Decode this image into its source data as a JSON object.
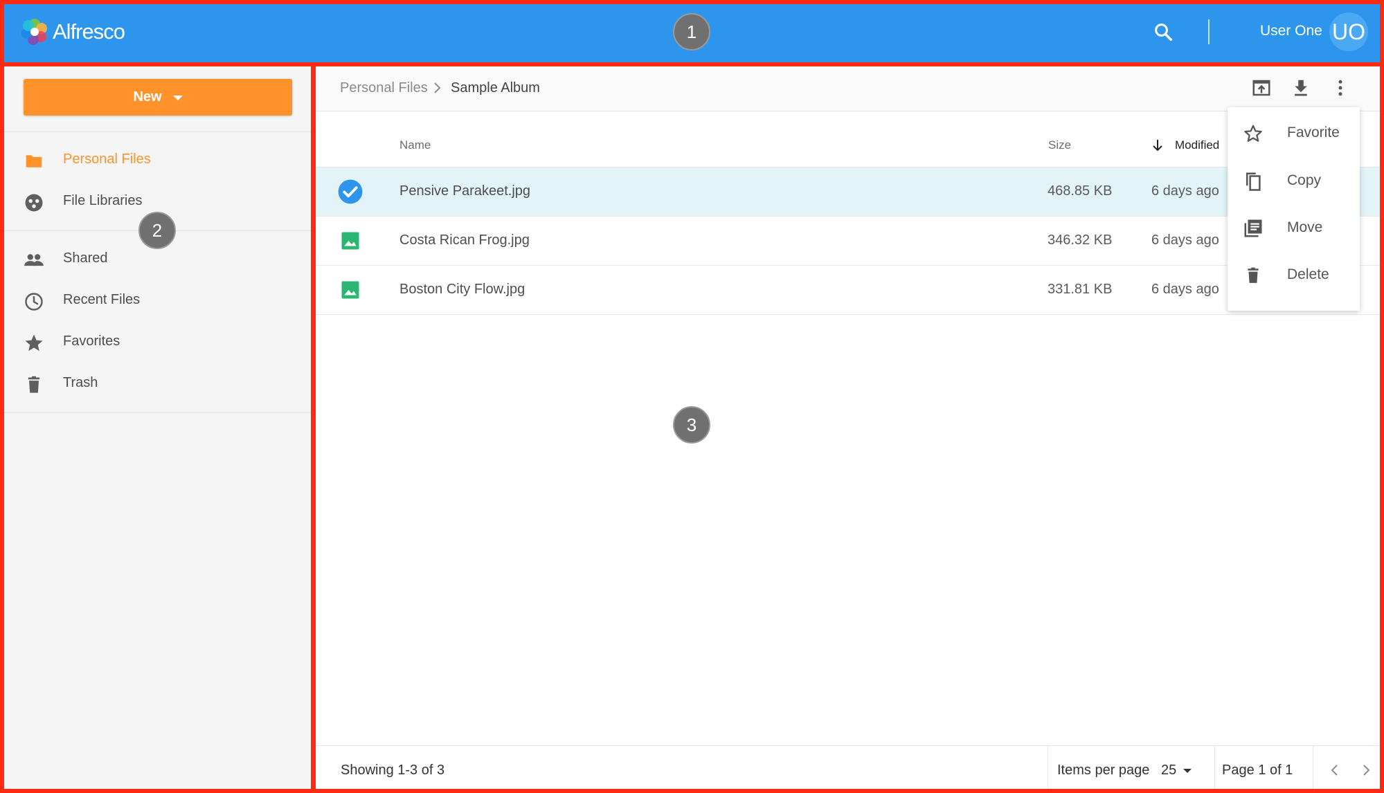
{
  "header": {
    "logo_text": "Alfresco",
    "user_name": "User One",
    "avatar_initials": "UO",
    "brand_color": "#2D96EC"
  },
  "sidebar": {
    "new_button": "New",
    "accent_color": "#FF922B",
    "items": [
      {
        "label": "Personal Files",
        "icon": "folder-icon",
        "active": true
      },
      {
        "label": "File Libraries",
        "icon": "libraries-icon",
        "active": false
      },
      {
        "label": "Shared",
        "icon": "people-icon",
        "active": false
      },
      {
        "label": "Recent Files",
        "icon": "clock-icon",
        "active": false
      },
      {
        "label": "Favorites",
        "icon": "star-icon",
        "active": false
      },
      {
        "label": "Trash",
        "icon": "trash-icon",
        "active": false
      }
    ]
  },
  "breadcrumb": {
    "parent": "Personal Files",
    "current": "Sample Album"
  },
  "table": {
    "columns": {
      "name": "Name",
      "size": "Size",
      "modified": "Modified"
    },
    "rows": [
      {
        "name": "Pensive Parakeet.jpg",
        "size": "468.85 KB",
        "modified": "6 days ago",
        "selected": true
      },
      {
        "name": "Costa Rican Frog.jpg",
        "size": "346.32 KB",
        "modified": "6 days ago",
        "selected": false
      },
      {
        "name": "Boston City Flow.jpg",
        "size": "331.81 KB",
        "modified": "6 days ago",
        "selected": false
      }
    ]
  },
  "context_menu": {
    "items": [
      {
        "label": "Favorite",
        "icon": "star-outline-icon"
      },
      {
        "label": "Copy",
        "icon": "copy-icon"
      },
      {
        "label": "Move",
        "icon": "move-icon"
      },
      {
        "label": "Delete",
        "icon": "delete-icon"
      }
    ]
  },
  "footer": {
    "showing": "Showing 1-3 of 3",
    "items_per_page_label": "Items per page",
    "items_per_page_value": "25",
    "page_info": "Page 1 of 1"
  },
  "callouts": [
    "1",
    "2",
    "3"
  ]
}
